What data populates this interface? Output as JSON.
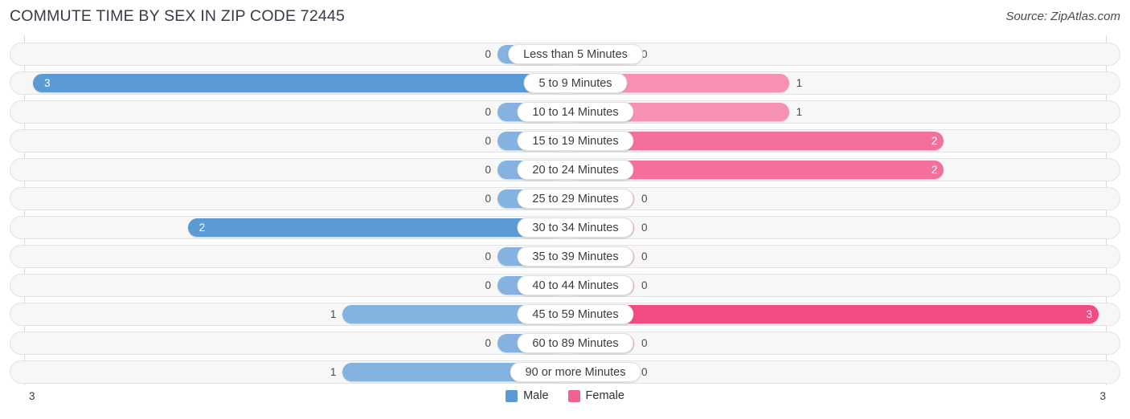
{
  "header": {
    "title": "COMMUTE TIME BY SEX IN ZIP CODE 72445",
    "source": "Source: ZipAtlas.com"
  },
  "legend": {
    "male_label": "Male",
    "female_label": "Female",
    "male_color": "#5b9bd5",
    "female_color": "#f0618f"
  },
  "axis": {
    "left_tick": "3",
    "right_tick": "3",
    "max": 3
  },
  "chart_data": {
    "type": "bar",
    "orientation": "horizontal-diverging",
    "title": "COMMUTE TIME BY SEX IN ZIP CODE 72445",
    "xlabel": "",
    "ylabel": "",
    "xlim": [
      3,
      3
    ],
    "grid": true,
    "legend_position": "bottom-center",
    "categories": [
      "Less than 5 Minutes",
      "5 to 9 Minutes",
      "10 to 14 Minutes",
      "15 to 19 Minutes",
      "20 to 24 Minutes",
      "25 to 29 Minutes",
      "30 to 34 Minutes",
      "35 to 39 Minutes",
      "40 to 44 Minutes",
      "45 to 59 Minutes",
      "60 to 89 Minutes",
      "90 or more Minutes"
    ],
    "series": [
      {
        "name": "Male",
        "color": "#5b9bd5",
        "values": [
          0,
          3,
          0,
          0,
          0,
          0,
          2,
          0,
          0,
          1,
          0,
          1
        ]
      },
      {
        "name": "Female",
        "color": "#f0618f",
        "values": [
          0,
          1,
          1,
          2,
          2,
          0,
          0,
          0,
          0,
          3,
          0,
          0
        ]
      }
    ]
  },
  "rows": [
    {
      "label": "Less than 5 Minutes",
      "male": "0",
      "female": "0"
    },
    {
      "label": "5 to 9 Minutes",
      "male": "3",
      "female": "1"
    },
    {
      "label": "10 to 14 Minutes",
      "male": "0",
      "female": "1"
    },
    {
      "label": "15 to 19 Minutes",
      "male": "0",
      "female": "2"
    },
    {
      "label": "20 to 24 Minutes",
      "male": "0",
      "female": "2"
    },
    {
      "label": "25 to 29 Minutes",
      "male": "0",
      "female": "0"
    },
    {
      "label": "30 to 34 Minutes",
      "male": "2",
      "female": "0"
    },
    {
      "label": "35 to 39 Minutes",
      "male": "0",
      "female": "0"
    },
    {
      "label": "40 to 44 Minutes",
      "male": "0",
      "female": "0"
    },
    {
      "label": "45 to 59 Minutes",
      "male": "1",
      "female": "3"
    },
    {
      "label": "60 to 89 Minutes",
      "male": "0",
      "female": "0"
    },
    {
      "label": "90 or more Minutes",
      "male": "1",
      "female": "0"
    }
  ]
}
